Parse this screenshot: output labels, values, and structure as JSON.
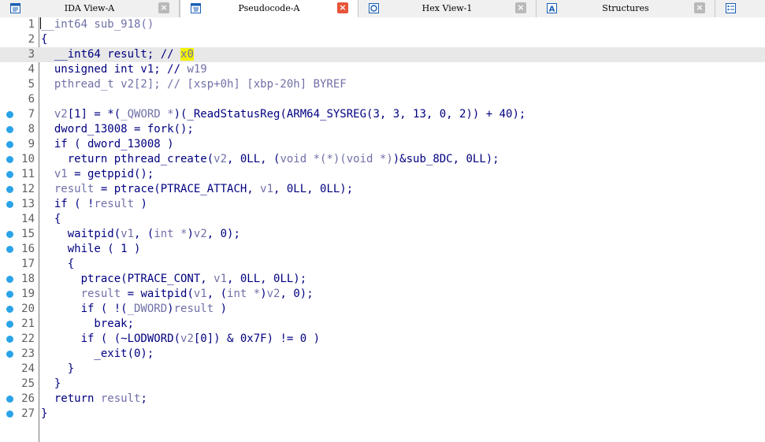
{
  "tabs": [
    {
      "label": "IDA View-A",
      "icon": "ida-view-icon",
      "active": false
    },
    {
      "label": "Pseudocode-A",
      "icon": "pseudocode-icon",
      "active": true
    },
    {
      "label": "Hex View-1",
      "icon": "hex-view-icon",
      "active": false
    },
    {
      "label": "Structures",
      "icon": "structures-icon",
      "active": false
    },
    {
      "label": "",
      "icon": "enums-icon",
      "active": false
    }
  ],
  "colors": {
    "breakpoint_dot": "#2aa3e8",
    "keyword": "#000080",
    "variable": "#7070a8",
    "highlight": "#f2f200",
    "active_close": "#e8553a"
  },
  "current_line": 3,
  "lines": [
    {
      "n": "1",
      "bp": false
    },
    {
      "n": "2",
      "bp": false
    },
    {
      "n": "3",
      "bp": false
    },
    {
      "n": "4",
      "bp": false
    },
    {
      "n": "5",
      "bp": false
    },
    {
      "n": "6",
      "bp": false
    },
    {
      "n": "7",
      "bp": true
    },
    {
      "n": "8",
      "bp": true
    },
    {
      "n": "9",
      "bp": true
    },
    {
      "n": "10",
      "bp": true
    },
    {
      "n": "11",
      "bp": true
    },
    {
      "n": "12",
      "bp": true
    },
    {
      "n": "13",
      "bp": true
    },
    {
      "n": "14",
      "bp": false
    },
    {
      "n": "15",
      "bp": true
    },
    {
      "n": "16",
      "bp": true
    },
    {
      "n": "17",
      "bp": false
    },
    {
      "n": "18",
      "bp": true
    },
    {
      "n": "19",
      "bp": true
    },
    {
      "n": "20",
      "bp": true
    },
    {
      "n": "21",
      "bp": true
    },
    {
      "n": "22",
      "bp": true
    },
    {
      "n": "23",
      "bp": true
    },
    {
      "n": "24",
      "bp": false
    },
    {
      "n": "25",
      "bp": false
    },
    {
      "n": "26",
      "bp": true
    },
    {
      "n": "27",
      "bp": true
    }
  ],
  "code": [
    [
      [
        "var",
        "__int64 sub_918()"
      ]
    ],
    [
      [
        "kw",
        "{"
      ]
    ],
    [
      [
        "kw",
        "  __int64 result; // "
      ],
      [
        "hl",
        "x0"
      ]
    ],
    [
      [
        "kw",
        "  unsigned int v1; // "
      ],
      [
        "cmt",
        "w19"
      ]
    ],
    [
      [
        "var",
        "  pthread_t v2[2]; // [xsp+0h] [xbp-20h] BYREF"
      ]
    ],
    [
      [
        "kw",
        ""
      ]
    ],
    [
      [
        "var",
        "  v2"
      ],
      [
        "kw",
        "[1] = *("
      ],
      [
        "var",
        "_QWORD *"
      ],
      [
        "kw",
        ")(_ReadStatusReg(ARM64_SYSREG(3, 3, 13, 0, 2)) + 40);"
      ]
    ],
    [
      [
        "kw",
        "  dword_13008 = fork();"
      ]
    ],
    [
      [
        "kw",
        "  if ( dword_13008 )"
      ]
    ],
    [
      [
        "kw",
        "    return pthread_create("
      ],
      [
        "var",
        "v2"
      ],
      [
        "kw",
        ", 0LL, ("
      ],
      [
        "var",
        "void *(*)(void *)"
      ],
      [
        "kw",
        ")&sub_8DC, 0LL);"
      ]
    ],
    [
      [
        "var",
        "  v1"
      ],
      [
        "kw",
        " = getppid();"
      ]
    ],
    [
      [
        "var",
        "  result"
      ],
      [
        "kw",
        " = ptrace(PTRACE_ATTACH, "
      ],
      [
        "var",
        "v1"
      ],
      [
        "kw",
        ", 0LL, 0LL);"
      ]
    ],
    [
      [
        "kw",
        "  if ( !"
      ],
      [
        "var",
        "result"
      ],
      [
        "kw",
        " )"
      ]
    ],
    [
      [
        "kw",
        "  {"
      ]
    ],
    [
      [
        "kw",
        "    waitpid("
      ],
      [
        "var",
        "v1"
      ],
      [
        "kw",
        ", ("
      ],
      [
        "var",
        "int *"
      ],
      [
        "kw",
        ")"
      ],
      [
        "var",
        "v2"
      ],
      [
        "kw",
        ", 0);"
      ]
    ],
    [
      [
        "kw",
        "    while ( 1 )"
      ]
    ],
    [
      [
        "kw",
        "    {"
      ]
    ],
    [
      [
        "kw",
        "      ptrace(PTRACE_CONT, "
      ],
      [
        "var",
        "v1"
      ],
      [
        "kw",
        ", 0LL, 0LL);"
      ]
    ],
    [
      [
        "var",
        "      result"
      ],
      [
        "kw",
        " = waitpid("
      ],
      [
        "var",
        "v1"
      ],
      [
        "kw",
        ", ("
      ],
      [
        "var",
        "int *"
      ],
      [
        "kw",
        ")"
      ],
      [
        "var",
        "v2"
      ],
      [
        "kw",
        ", 0);"
      ]
    ],
    [
      [
        "kw",
        "      if ( !("
      ],
      [
        "var",
        "_DWORD"
      ],
      [
        "kw",
        ")"
      ],
      [
        "var",
        "result"
      ],
      [
        "kw",
        " )"
      ]
    ],
    [
      [
        "kw",
        "        break;"
      ]
    ],
    [
      [
        "kw",
        "      if ( (~LODWORD("
      ],
      [
        "var",
        "v2"
      ],
      [
        "kw",
        "[0]) & 0x7F) != 0 )"
      ]
    ],
    [
      [
        "kw",
        "        _exit(0);"
      ]
    ],
    [
      [
        "kw",
        "    }"
      ]
    ],
    [
      [
        "kw",
        "  }"
      ]
    ],
    [
      [
        "kw",
        "  return "
      ],
      [
        "var",
        "result"
      ],
      [
        "kw",
        ";"
      ]
    ],
    [
      [
        "kw",
        "}"
      ]
    ]
  ]
}
